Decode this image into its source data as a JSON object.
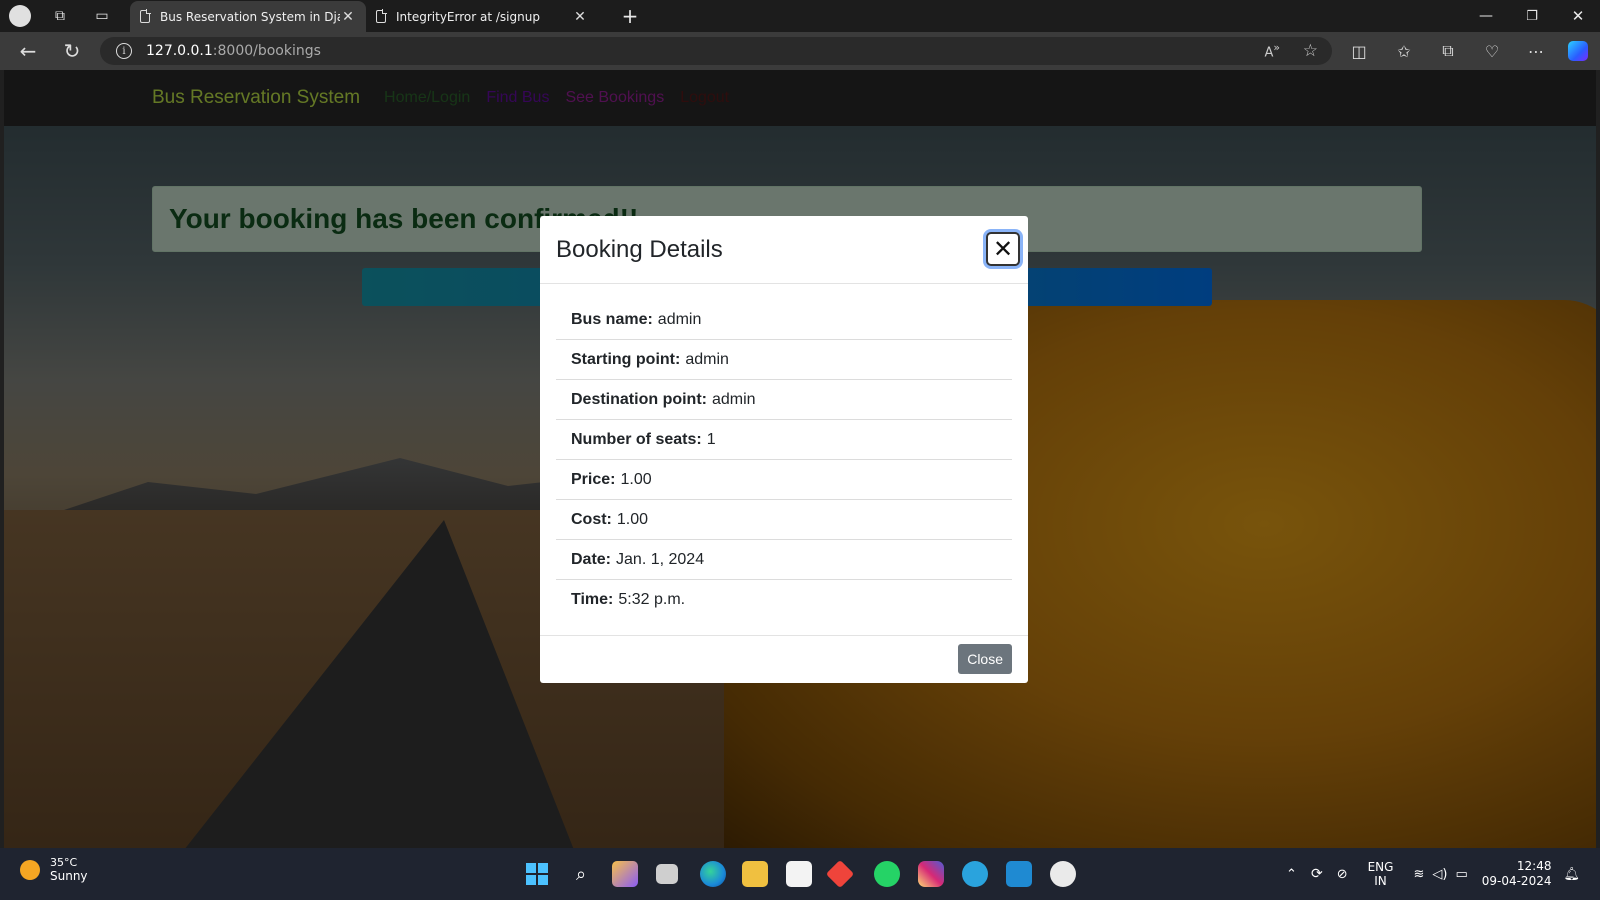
{
  "browser": {
    "tabs": [
      {
        "title": "Bus Reservation System in Djang",
        "active": true
      },
      {
        "title": "IntegrityError at /signup",
        "active": false
      }
    ],
    "url_host": "127.0.0.1",
    "url_path": ":8000/bookings"
  },
  "navbar": {
    "brand": "Bus Reservation System",
    "links": [
      {
        "label": "Home/Login",
        "color": "#2e6b2e"
      },
      {
        "label": "Find Bus",
        "color": "#6a0dad"
      },
      {
        "label": "See Bookings",
        "color": "#a020a0"
      },
      {
        "label": "Logout",
        "color": "#5c1a1a"
      }
    ]
  },
  "alert": {
    "message": "Your booking has been confirmed!!"
  },
  "modal": {
    "title": "Booking Details",
    "close_x": "✕",
    "rows": [
      {
        "label": "Bus name:",
        "value": "admin"
      },
      {
        "label": "Starting point:",
        "value": "admin"
      },
      {
        "label": "Destination point:",
        "value": "admin"
      },
      {
        "label": "Number of seats:",
        "value": "1"
      },
      {
        "label": "Price:",
        "value": "1.00"
      },
      {
        "label": "Cost:",
        "value": "1.00"
      },
      {
        "label": "Date:",
        "value": "Jan. 1, 2024"
      },
      {
        "label": "Time:",
        "value": "5:32 p.m."
      }
    ],
    "close_button": "Close"
  },
  "taskbar": {
    "weather_temp": "35°C",
    "weather_cond": "Sunny",
    "lang_top": "ENG",
    "lang_bottom": "IN",
    "time": "12:48",
    "date": "09-04-2024"
  },
  "colors": {
    "accent_blue": "#007bff",
    "alert_bg": "#d4edda",
    "alert_text": "#155724",
    "brand": "#c8f04a"
  }
}
